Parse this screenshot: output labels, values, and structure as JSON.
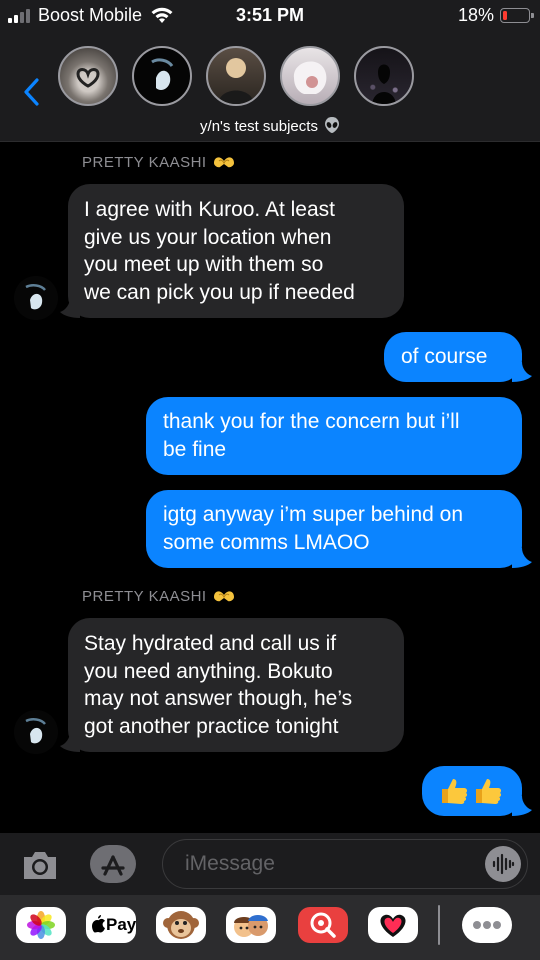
{
  "status_bar": {
    "carrier": "Boost Mobile",
    "time": "3:51 PM",
    "battery_percent": "18%",
    "battery_level": 0.18,
    "battery_color": "#ff3b30"
  },
  "header": {
    "back_icon": "chevron-left-icon",
    "group_name": "y/n's test subjects",
    "group_emoji": "alien-icon",
    "avatar_count": 5
  },
  "messages": [
    {
      "type": "sender",
      "name": "PRETTY KAASHI",
      "emoji": "heart-hands-icon"
    },
    {
      "type": "incoming",
      "lines": [
        "I agree with Kuroo. At least",
        "give us your location when",
        "you meet up with them so",
        "we can pick you up if needed"
      ]
    },
    {
      "type": "outgoing",
      "lines": [
        "of course"
      ]
    },
    {
      "type": "outgoing",
      "lines": [
        "thank you for the concern but i’ll",
        "be fine"
      ]
    },
    {
      "type": "outgoing",
      "lines": [
        "igtg anyway i’m super behind on",
        "some comms LMAOO"
      ]
    },
    {
      "type": "sender",
      "name": "PRETTY KAASHI",
      "emoji": "heart-hands-icon"
    },
    {
      "type": "incoming",
      "lines": [
        "Stay hydrated and call us if",
        "you need anything. Bokuto",
        "may not answer though, he’s",
        "got another practice tonight"
      ]
    },
    {
      "type": "outgoing",
      "emoji": "thumbs-up-icon",
      "count": 2
    }
  ],
  "input_bar": {
    "camera_icon": "camera-icon",
    "apps_icon": "app-store-icon",
    "placeholder": "iMessage",
    "audio_icon": "audio-waveform-icon"
  },
  "app_drawer": {
    "apps": [
      "photos-icon",
      "apple-pay-icon",
      "monkey-memoji-icon",
      "memoji-icon",
      "image-search-icon",
      "digital-touch-icon",
      "more-icon"
    ],
    "apple_pay_label": "Pay"
  },
  "colors": {
    "outgoing_bubble": "#0b84ff",
    "incoming_bubble": "#262628",
    "header_bg": "#1c1c1e",
    "background": "#000000"
  }
}
